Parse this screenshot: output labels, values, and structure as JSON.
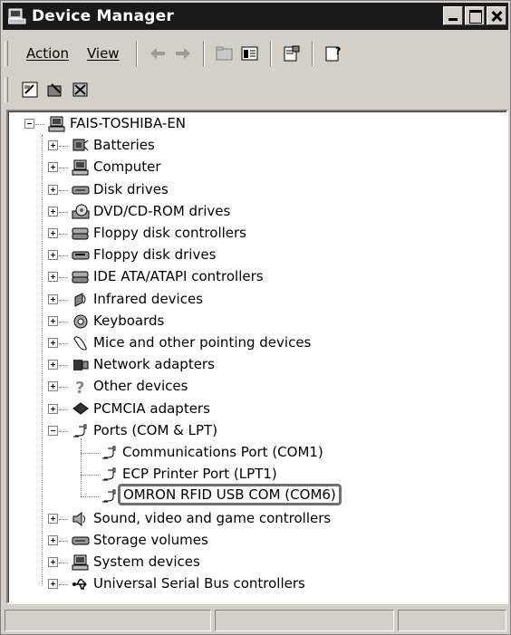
{
  "window": {
    "title": "Device Manager"
  },
  "menu": {
    "action": "Action",
    "view": "View"
  },
  "tree": {
    "root": "FAIS-TOSHIBA-EN",
    "categories": [
      {
        "label": "Batteries",
        "icon": "battery-icon"
      },
      {
        "label": "Computer",
        "icon": "computer-icon"
      },
      {
        "label": "Disk drives",
        "icon": "disk-drive-icon"
      },
      {
        "label": "DVD/CD-ROM drives",
        "icon": "cdrom-icon"
      },
      {
        "label": "Floppy disk controllers",
        "icon": "floppy-controller-icon"
      },
      {
        "label": "Floppy disk drives",
        "icon": "floppy-drive-icon"
      },
      {
        "label": "IDE ATA/ATAPI controllers",
        "icon": "ide-controller-icon"
      },
      {
        "label": "Infrared devices",
        "icon": "infrared-icon"
      },
      {
        "label": "Keyboards",
        "icon": "keyboard-icon"
      },
      {
        "label": "Mice and other pointing devices",
        "icon": "mouse-icon"
      },
      {
        "label": "Network adapters",
        "icon": "network-adapter-icon"
      },
      {
        "label": "Other devices",
        "icon": "question-icon"
      },
      {
        "label": "PCMCIA adapters",
        "icon": "pcmcia-icon"
      },
      {
        "label": "Ports (COM & LPT)",
        "icon": "port-icon"
      }
    ],
    "ports_children": [
      {
        "label": "Communications Port (COM1)",
        "icon": "port-icon"
      },
      {
        "label": "ECP Printer Port (LPT1)",
        "icon": "port-icon"
      },
      {
        "label": "OMRON RFID USB COM (COM6)",
        "icon": "port-icon"
      }
    ],
    "after_categories": [
      {
        "label": "Sound, video and game controllers",
        "icon": "sound-icon"
      },
      {
        "label": "Storage volumes",
        "icon": "storage-icon"
      },
      {
        "label": "System devices",
        "icon": "system-device-icon"
      },
      {
        "label": "Universal Serial Bus controllers",
        "icon": "usb-icon"
      }
    ]
  }
}
